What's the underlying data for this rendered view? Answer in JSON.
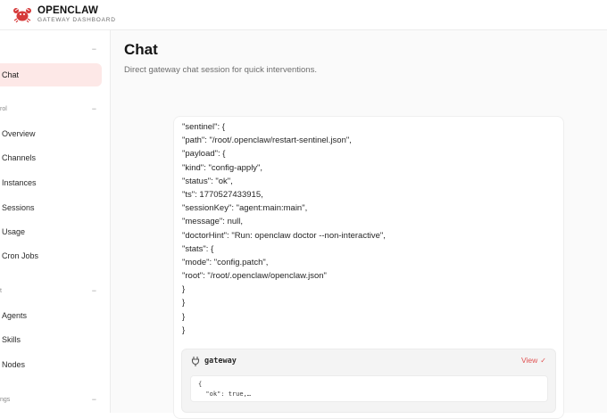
{
  "brand": {
    "title": "OPENCLAW",
    "subtitle": "GATEWAY DASHBOARD",
    "logo_icon": "crab-logo-icon",
    "accent_color": "#d63a3a"
  },
  "sidebar": {
    "groups": [
      {
        "label": "",
        "toggle": "−"
      },
      {
        "label": "rol",
        "toggle": "−"
      },
      {
        "label": "t",
        "toggle": "−"
      },
      {
        "label": "ngs",
        "toggle": "−"
      }
    ],
    "items": [
      {
        "label": "Chat",
        "active": true
      },
      {
        "label": "Overview"
      },
      {
        "label": "Channels"
      },
      {
        "label": "Instances"
      },
      {
        "label": "Sessions"
      },
      {
        "label": "Usage"
      },
      {
        "label": "Cron Jobs"
      },
      {
        "label": "Agents"
      },
      {
        "label": "Skills"
      },
      {
        "label": "Nodes"
      }
    ],
    "active_bg": "#fde8e7"
  },
  "main": {
    "title": "Chat",
    "subtitle": "Direct gateway chat session for quick interventions."
  },
  "chat": {
    "json_lines": [
      "\"sentinel\": {",
      "\"path\": \"/root/.openclaw/restart-sentinel.json\",",
      "\"payload\": {",
      "\"kind\": \"config-apply\",",
      "\"status\": \"ok\",",
      "\"ts\": 1770527433915,",
      "\"sessionKey\": \"agent:main:main\",",
      "\"message\": null,",
      "\"doctorHint\": \"Run: openclaw doctor --non-interactive\",",
      "\"stats\": {",
      "\"mode\": \"config.patch\",",
      "\"root\": \"/root/.openclaw/openclaw.json\"",
      "}",
      "}",
      "}",
      "}"
    ],
    "tool": {
      "icon": "plug-icon",
      "name": "gateway",
      "view_label": "View",
      "view_check": "✓",
      "output_lines": [
        "{",
        "  \"ok\": true,…"
      ]
    }
  }
}
